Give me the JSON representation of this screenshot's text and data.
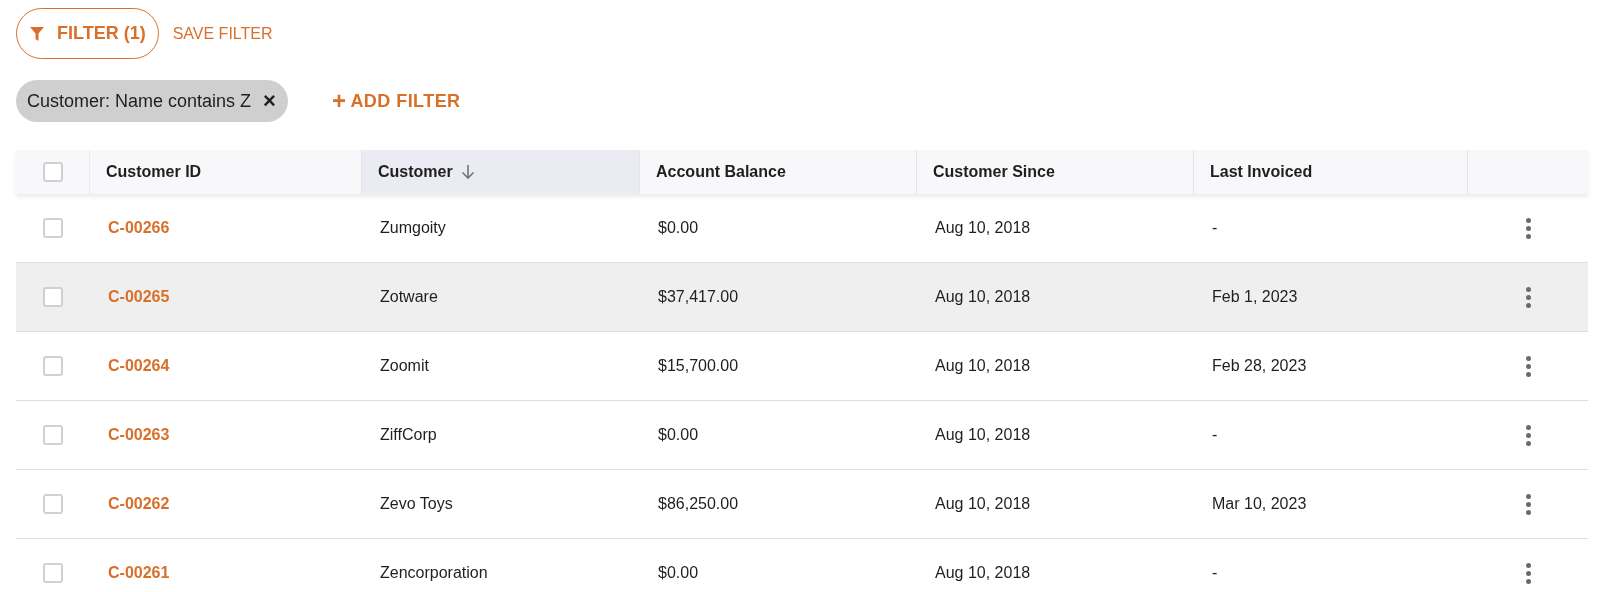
{
  "filter_button": {
    "label": "FILTER (1)"
  },
  "save_filter": {
    "label": "SAVE FILTER"
  },
  "filter_chips": [
    {
      "label": "Customer: Name contains Z",
      "remove": "×"
    }
  ],
  "add_filter": {
    "icon": "+",
    "label": "ADD FILTER"
  },
  "table": {
    "select_all": {
      "checked": false
    },
    "columns": [
      {
        "label": "Customer ID",
        "sorted": false
      },
      {
        "label": "Customer",
        "sorted": true
      },
      {
        "label": "Account Balance",
        "sorted": false
      },
      {
        "label": "Customer Since",
        "sorted": false
      },
      {
        "label": "Last Invoiced",
        "sorted": false
      }
    ],
    "rows": [
      {
        "checked": false,
        "hovered": false,
        "cells": [
          "C-00266",
          "Zumgoity",
          "$0.00",
          "Aug 10, 2018",
          "-"
        ]
      },
      {
        "checked": false,
        "hovered": true,
        "cells": [
          "C-00265",
          "Zotware",
          "$37,417.00",
          "Aug 10, 2018",
          "Feb 1, 2023"
        ]
      },
      {
        "checked": false,
        "hovered": false,
        "cells": [
          "C-00264",
          "Zoomit",
          "$15,700.00",
          "Aug 10, 2018",
          "Feb 28, 2023"
        ]
      },
      {
        "checked": false,
        "hovered": false,
        "cells": [
          "C-00263",
          "ZiffCorp",
          "$0.00",
          "Aug 10, 2018",
          "-"
        ]
      },
      {
        "checked": false,
        "hovered": false,
        "cells": [
          "C-00262",
          "Zevo Toys",
          "$86,250.00",
          "Aug 10, 2018",
          "Mar 10, 2023"
        ]
      },
      {
        "checked": false,
        "hovered": false,
        "cells": [
          "C-00261",
          "Zencorporation",
          "$0.00",
          "Aug 10, 2018",
          "-"
        ]
      }
    ]
  }
}
